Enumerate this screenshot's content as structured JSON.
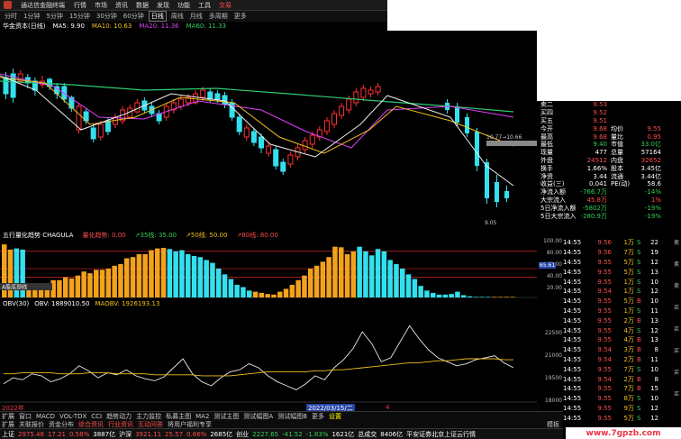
{
  "app": {
    "title": "通达信金融终端",
    "menus": [
      "行情",
      "市场",
      "资讯",
      "数据",
      "发现",
      "功能",
      "工具",
      "交易"
    ]
  },
  "toolbar": {
    "periods": [
      "分时",
      "1分钟",
      "5分钟",
      "15分钟",
      "30分钟",
      "60分钟",
      "日线",
      "周线",
      "月线",
      "多周期",
      "更多"
    ],
    "active": "日线"
  },
  "chart_header": {
    "name": "华金资本(日线)",
    "ma5": "MA5: 9.90",
    "ma10": "MA10: 10.63",
    "ma20": "MA20: 11.36",
    "ma60": "MA60: 11.33"
  },
  "colors": {
    "up": "#ff4c4c",
    "down": "#34d058",
    "bar_up": "#ff3030",
    "bar_cyan": "#33e0ee",
    "bar_orange": "#f3a21e"
  },
  "price_axis": [
    "11.50",
    "11.25",
    "11.00",
    "10.75",
    "10.50",
    "10.25",
    "10.00",
    "9.75",
    "9.50",
    "9.25"
  ],
  "price_annotations": {
    "hi": "10.77→10.66",
    "lo": "9.05"
  },
  "quote": {
    "rows": [
      {
        "k": "卖二",
        "v": "9.53",
        "k2": "",
        "v2": "",
        "c": "red"
      },
      {
        "k": "买四",
        "v": "9.52",
        "k2": "",
        "v2": "",
        "c": "red"
      },
      {
        "k": "买五",
        "v": "9.51",
        "k2": "",
        "v2": "",
        "c": "red"
      },
      {
        "k": "今开",
        "v": "9.68",
        "k2": "均价",
        "v2": "9.55",
        "c": "red"
      },
      {
        "k": "最高",
        "v": "9.68",
        "k2": "量比",
        "v2": "0.95",
        "c": "red"
      },
      {
        "k": "最低",
        "v": "9.40",
        "k2": "市值",
        "v2": "33.0亿",
        "c": "green"
      },
      {
        "k": "现量",
        "v": "477",
        "k2": "总量",
        "v2": "57164",
        "c": "white"
      },
      {
        "k": "外盘",
        "v": "24512",
        "k2": "内盘",
        "v2": "32652",
        "c": "red"
      },
      {
        "k": "换手",
        "v": "1.66%",
        "k2": "股本",
        "v2": "3.45亿",
        "c": "white"
      },
      {
        "k": "净资",
        "v": "3.44",
        "k2": "流通",
        "v2": "3.44亿",
        "c": "white"
      },
      {
        "k": "收益(三)",
        "v": "0.041",
        "k2": "PE(动)",
        "v2": "58.6",
        "c": "white"
      },
      {
        "k": "净流入额",
        "v": "-766.7万",
        "k2": "",
        "v2": "-14%",
        "c": "green"
      },
      {
        "k": "大宗流入",
        "v": "45.8万",
        "k2": "",
        "v2": "1%",
        "c": "red"
      },
      {
        "k": "5日净流入额",
        "v": "-5802万",
        "k2": "",
        "v2": "-19%",
        "c": "green"
      },
      {
        "k": "5日大宗流入",
        "v": "-280.9万",
        "k2": "",
        "v2": "-19%",
        "c": "green"
      }
    ]
  },
  "right_scale": [
    "卖",
    "卖",
    "卖",
    "买",
    "买",
    "买",
    "买",
    "买"
  ],
  "trades": [
    {
      "t": "14:55",
      "p": "9.56",
      "v": "1",
      "u": "万",
      "s": "S",
      "n": "22"
    },
    {
      "t": "14:55",
      "p": "9.56",
      "v": "7",
      "u": "万",
      "s": "S",
      "n": "19"
    },
    {
      "t": "14:55",
      "p": "9.55",
      "v": "5",
      "u": "万",
      "s": "S",
      "n": "12"
    },
    {
      "t": "14:55",
      "p": "9.55",
      "v": "5",
      "u": "万",
      "s": "S",
      "n": "13"
    },
    {
      "t": "14:55",
      "p": "9.55",
      "v": "1",
      "u": "万",
      "s": "S",
      "n": "10"
    },
    {
      "t": "14:55",
      "p": "9.54",
      "v": "1",
      "u": "万",
      "s": "S",
      "n": "12"
    },
    {
      "t": "14:55",
      "p": "9.55",
      "v": "5",
      "u": "万",
      "s": "B",
      "n": "10"
    },
    {
      "t": "14:55",
      "p": "9.55",
      "v": "1",
      "u": "万",
      "s": "S",
      "n": "11"
    },
    {
      "t": "14:55",
      "p": "9.55",
      "v": "2",
      "u": "万",
      "s": "B",
      "n": "13"
    },
    {
      "t": "14:55",
      "p": "9.55",
      "v": "4",
      "u": "万",
      "s": "S",
      "n": "12"
    },
    {
      "t": "14:55",
      "p": "9.55",
      "v": "4",
      "u": "万",
      "s": "B",
      "n": "13"
    },
    {
      "t": "14:55",
      "p": "9.54",
      "v": "3",
      "u": "万",
      "s": "B",
      "n": "8"
    },
    {
      "t": "14:55",
      "p": "9.54",
      "v": "2",
      "u": "万",
      "s": "B",
      "n": "11"
    },
    {
      "t": "14:55",
      "p": "9.55",
      "v": "7",
      "u": "万",
      "s": "S",
      "n": "10"
    },
    {
      "t": "14:55",
      "p": "9.54",
      "v": "2",
      "u": "万",
      "s": "B",
      "n": "8"
    },
    {
      "t": "14:55",
      "p": "9.55",
      "v": "7",
      "u": "万",
      "s": "B",
      "n": "15"
    },
    {
      "t": "14:55",
      "p": "9.55",
      "v": "8",
      "u": "万",
      "s": "S",
      "n": "10"
    },
    {
      "t": "14:55",
      "p": "9.55",
      "v": "9",
      "u": "万",
      "s": "S",
      "n": "12"
    },
    {
      "t": "14:55",
      "p": "9.55",
      "v": "5",
      "u": "万",
      "s": "S",
      "n": "12"
    }
  ],
  "indicator1": {
    "title": "五行量化趋势 CHAGULA",
    "labels": [
      "量化趋势: 0.00",
      "↗35线: 35.00",
      "↗50线: 50.00",
      "↗80线: 80.00"
    ],
    "axis": [
      "100.00",
      "80.00",
      "60.00",
      "40.00",
      "20.00"
    ],
    "tag": "65.61",
    "left_tag": "A股底部线",
    "values": [
      92,
      83,
      85,
      83,
      20,
      23,
      18,
      22,
      30,
      30,
      35,
      33,
      38,
      45,
      42,
      48,
      48,
      50,
      55,
      58,
      68,
      70,
      75,
      75,
      82,
      85,
      86,
      84,
      80,
      82,
      75,
      72,
      70,
      65,
      60,
      50,
      40,
      32,
      22,
      18,
      12,
      10,
      8,
      6,
      5,
      10,
      15,
      22,
      30,
      38,
      50,
      55,
      62,
      70,
      88,
      87,
      75,
      80,
      88,
      80,
      73,
      84,
      80,
      65,
      58,
      50,
      40,
      32,
      20,
      12,
      8,
      5,
      5,
      6,
      10,
      4,
      2,
      1,
      1,
      1,
      1,
      1,
      1,
      1
    ],
    "colors": "ooccoooooooooooooooooooooooccccccccccccccooooooooooooooooocccccccccccccccccccccc"
  },
  "indicator2": {
    "title": "OBV(30)",
    "obv": "OBV: 1889010.50",
    "maobv": "MAOBV: 1926193.13",
    "axis": [
      "22500",
      "21000",
      "19500",
      "18000"
    ],
    "obv_series": [
      170,
      176,
      174,
      180,
      178,
      172,
      175,
      180,
      188,
      183,
      176,
      181,
      179,
      184,
      178,
      175,
      173,
      177,
      186,
      195,
      180,
      172,
      168,
      176,
      182,
      184,
      190,
      186,
      178,
      172,
      168,
      164,
      170,
      178,
      174,
      186,
      194,
      205,
      222,
      210,
      192,
      196,
      212,
      228,
      215,
      204,
      196,
      192,
      188,
      190,
      194,
      196,
      198,
      191,
      186
    ],
    "ma_series": [
      180,
      180,
      181,
      181,
      181,
      181,
      180,
      180,
      180,
      181,
      181,
      181,
      180,
      180,
      180,
      180,
      179,
      179,
      179,
      179,
      179,
      178,
      178,
      178,
      178,
      179,
      180,
      181,
      182,
      182,
      182,
      182,
      182,
      183,
      183,
      184,
      184,
      185,
      186,
      187,
      188,
      189,
      190,
      191,
      191,
      192,
      193,
      193,
      194,
      195,
      195,
      195,
      195,
      194,
      194
    ]
  },
  "timeline": {
    "left": "2022年",
    "date": "2022/03/15/二",
    "year": "4"
  },
  "tabs_row1": [
    "扩展",
    "窗口",
    "MACD",
    "VOL-TDX",
    "CCI",
    "趋势动力",
    "主力监控",
    "私募主图",
    "MA2",
    "测试主图",
    "测试幅图A",
    "测试幅图B",
    "更多",
    "设置"
  ],
  "tabs_row2": [
    "扩展",
    "关联报价",
    "资金分布",
    "综合资讯",
    "行业资讯",
    "互动问答",
    "将用户福利专享"
  ],
  "tabs_row2_end": "模板",
  "status": {
    "sh_label": "上证",
    "sh_val": "2975.48",
    "sh_chg": "17.21",
    "sh_pct": "0.58%",
    "sh_amt": "3887亿",
    "sz_label": "沪深",
    "sz_val": "3921.11",
    "sz_chg": "25.57",
    "sz_pct": "0.66%",
    "sz_amt": "2685亿",
    "cy_label": "创业",
    "cy_val": "2227.65",
    "cy_chg": "-41.52",
    "cy_pct": "-1.83%",
    "cy_amt": "1621亿",
    "total_label": "总成交",
    "total_amt": "8406亿",
    "server": "平安证券北京上证云行情"
  },
  "watermark": "www.7gpzb.com"
}
